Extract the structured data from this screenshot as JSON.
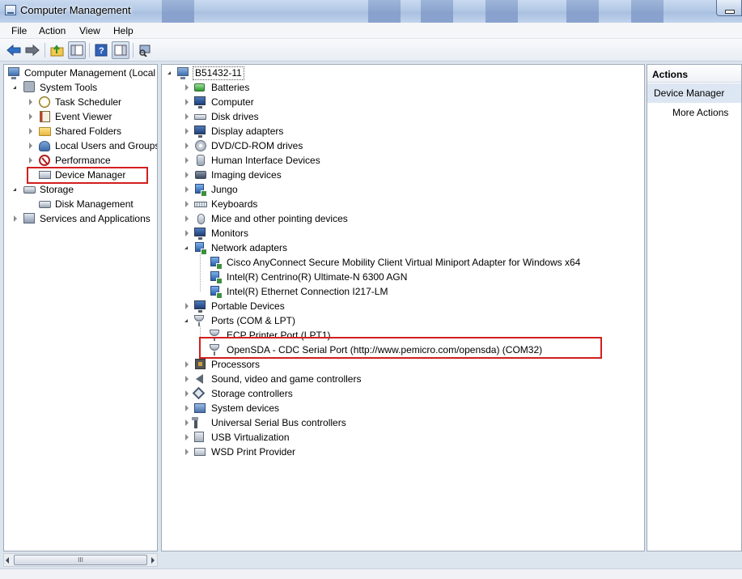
{
  "window": {
    "title": "Computer Management"
  },
  "menu": [
    "File",
    "Action",
    "View",
    "Help"
  ],
  "left_tree": {
    "root": "Computer Management (Local",
    "system_tools": "System Tools",
    "task_scheduler": "Task Scheduler",
    "event_viewer": "Event Viewer",
    "shared_folders": "Shared Folders",
    "local_users": "Local Users and Groups",
    "performance": "Performance",
    "device_manager": "Device Manager",
    "storage": "Storage",
    "disk_management": "Disk Management",
    "services": "Services and Applications"
  },
  "scrollbar": {
    "grip": "III"
  },
  "device_tree": {
    "computer_name": "B51432-11",
    "categories": [
      "Batteries",
      "Computer",
      "Disk drives",
      "Display adapters",
      "DVD/CD-ROM drives",
      "Human Interface Devices",
      "Imaging devices",
      "Jungo",
      "Keyboards",
      "Mice and other pointing devices",
      "Monitors",
      "Network adapters"
    ],
    "network_adapters": [
      "Cisco AnyConnect Secure Mobility Client Virtual Miniport Adapter for Windows x64",
      "Intel(R) Centrino(R) Ultimate-N 6300 AGN",
      "Intel(R) Ethernet Connection I217-LM"
    ],
    "portable_devices": "Portable Devices",
    "ports": "Ports (COM & LPT)",
    "ports_children": [
      "ECP Printer Port (LPT1)",
      "OpenSDA - CDC Serial Port (http://www.pemicro.com/opensda) (COM32)"
    ],
    "categories_after": [
      "Processors",
      "Sound, video and game controllers",
      "Storage controllers",
      "System devices",
      "Universal Serial Bus controllers",
      "USB Virtualization",
      "WSD Print Provider"
    ]
  },
  "actions": {
    "header": "Actions",
    "section": "Device Manager",
    "more": "More Actions"
  },
  "colors": {
    "highlight": "#d21f1f",
    "actions_section_bg": "#dde7f3"
  }
}
